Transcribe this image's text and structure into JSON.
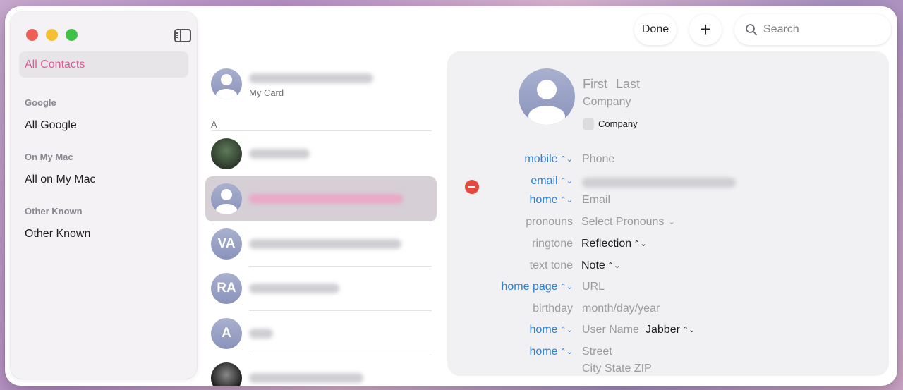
{
  "sidebar": {
    "selected_item": "All Contacts",
    "groups": [
      {
        "header": "Google",
        "item": "All Google"
      },
      {
        "header": "On My Mac",
        "item": "All on My Mac"
      },
      {
        "header": "Other Known",
        "item": "Other Known"
      }
    ]
  },
  "toolbar": {
    "done_label": "Done",
    "add_label": "+",
    "search_placeholder": "Search"
  },
  "contact_list": {
    "my_card_subtitle": "My Card",
    "section_letter": "A",
    "initials": [
      "VA",
      "RA",
      "A"
    ]
  },
  "detail": {
    "first_placeholder": "First",
    "last_placeholder": "Last",
    "company_placeholder": "Company",
    "company_checkbox_label": "Company",
    "fields": {
      "mobile_label": "mobile",
      "phone_placeholder": "Phone",
      "email_label": "email",
      "home_email_label": "home",
      "email_placeholder": "Email",
      "pronouns_label": "pronouns",
      "pronouns_value": "Select Pronouns",
      "ringtone_label": "ringtone",
      "ringtone_value": "Reflection",
      "texttone_label": "text tone",
      "texttone_value": "Note",
      "homepage_label": "home page",
      "url_placeholder": "URL",
      "birthday_label": "birthday",
      "birthday_placeholder": "month/day/year",
      "im_label": "home",
      "username_placeholder": "User Name",
      "im_service": "Jabber",
      "address_label": "home",
      "street_placeholder": "Street",
      "city_placeholder": "City State ZIP"
    }
  },
  "colors": {
    "accent_pink": "#e05a9a",
    "label_blue": "#2f7fd8",
    "remove_red": "#e5483f"
  }
}
